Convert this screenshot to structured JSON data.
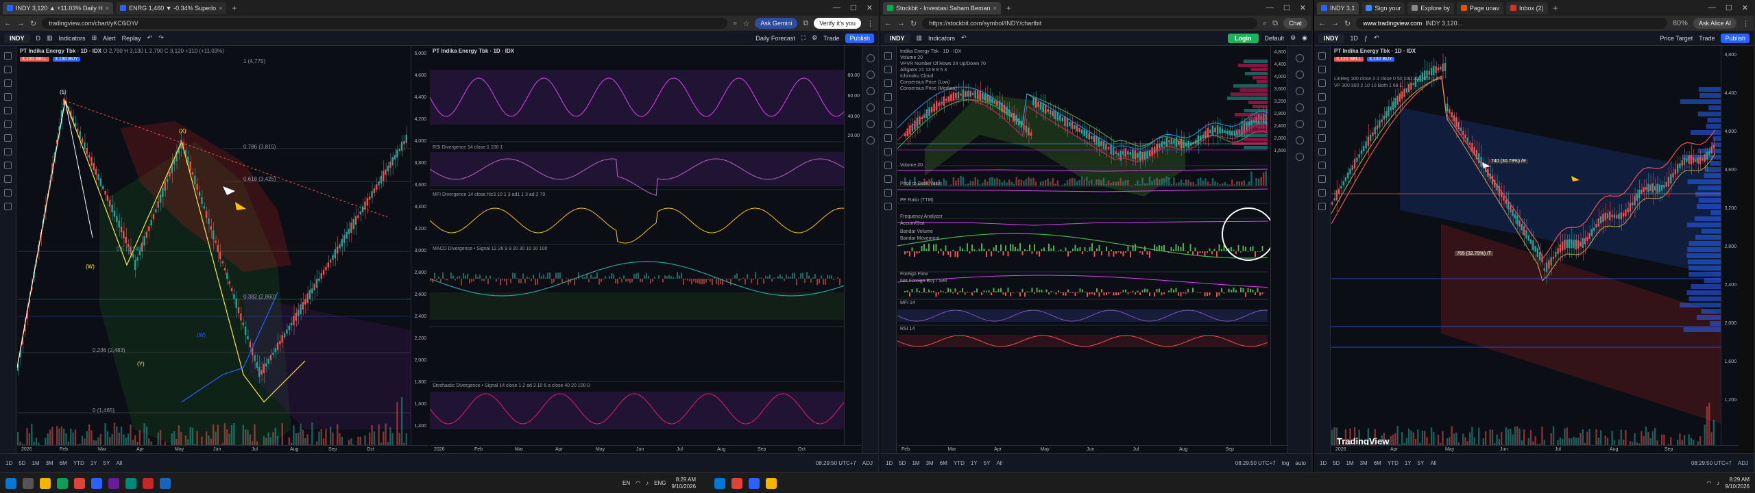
{
  "w1": {
    "tabs": [
      {
        "label": "INDY 3,120 ▲ +11.03% Daily H",
        "active": true
      },
      {
        "label": "ENRG 1,460 ▼ -0.34% Superlo",
        "active": false
      }
    ],
    "url": "tradingview.com/chart/yKC6iDYi/",
    "ask_label": "Ask Gemini",
    "verify_label": "Verify it's you",
    "toolbar": {
      "symbol": "INDY",
      "interval": "D",
      "indicators": "Indicators",
      "alert": "Alert",
      "replay": "Replay",
      "forecast": "Daily Forecast",
      "trade": "Trade",
      "publish": "Publish"
    },
    "main_legend": "PT Indika Energy Tbk · 1D · IDX",
    "main_values": "O 2,790 H 3,130 L 2,790 C 3,120 +310 (+11.03%)",
    "sell_badge": "3,120 SELL",
    "buy_badge": "3,130 BUY",
    "wave_labels": [
      "(5)",
      "(W)",
      "(X)",
      "(Y)",
      "(W)"
    ],
    "fib_labels": [
      "1 (4,775)",
      "0.786 (3,815)",
      "0.618 (3,425)",
      "0.5 (3,148)",
      "0.382 (2,860)",
      "0.236 (2,483)",
      "0 (1,465)"
    ],
    "price_axis": [
      "5,000",
      "4,600",
      "4,400",
      "4,200",
      "4,000",
      "3,800",
      "3,600",
      "3,400",
      "3,200",
      "3,000",
      "2,800",
      "2,600",
      "2,400",
      "2,200",
      "2,000",
      "1,800",
      "1,600",
      "1,400"
    ],
    "time_axis": [
      "2026",
      "Feb",
      "Mar",
      "Apr",
      "May",
      "Jun",
      "Jul",
      "Aug",
      "Sep",
      "Oct"
    ],
    "panel2_legend": "PT Indika Energy Tbk · 1D · IDX",
    "ind_legends": [
      "RSI Divergence 14 close 1 100 1",
      "MFI Divergence 14 close hlc3 10 1 3 ad1 1 3 ad 2 70",
      "MACD Divergence • Signal 12 26 9 9 20 30 10 10 100",
      "Stochastic Divergence • Signal 14 close 1 2 ad 3 10 6 a close 40 20 100 0"
    ],
    "osc_axis": [
      "80.00",
      "60.00",
      "40.00",
      "20.00"
    ],
    "ranges": [
      "1D",
      "5D",
      "1M",
      "3M",
      "6M",
      "YTD",
      "1Y",
      "5Y",
      "All"
    ],
    "time_status": "08:29:50 UTC+7",
    "adj": "ADJ"
  },
  "w2": {
    "tab_label": "Stockbit - Investasi Saham Beman",
    "url": "https://stockbit.com/symbol/INDY/chartbit",
    "chat": "Chat",
    "toolbar": {
      "symbol": "INDY",
      "indicators": "Indicators",
      "login": "Login",
      "default": "Default"
    },
    "legend_lines": [
      "Indika Energy Tbk · 1D · IDX",
      "Volume 20",
      "VPVR Number Of Rows 24 Up/Down 70",
      "Alligator 21 13 8 8 5 3",
      "Ichimoku Cloud",
      "Consensus Price (Low)",
      "Consensus Price (Median)"
    ],
    "panels": [
      "Volume 20",
      "Price to Book Value",
      "PE Ratio (TTM)",
      "Frequency Analyzer",
      "Accum/Dist",
      "Bandar Volume",
      "Bandar Movement",
      "Foreign Flow",
      "Net Foreign Buy / Sell",
      "MFI 14",
      "RSI 14"
    ],
    "price_axis": [
      "4,800",
      "4,400",
      "4,000",
      "3,600",
      "3,200",
      "2,800",
      "2,400",
      "2,000",
      "1,600"
    ],
    "time_axis": [
      "Feb",
      "Mar",
      "Apr",
      "May",
      "Jun",
      "Jul",
      "Aug",
      "Sep"
    ],
    "ranges": [
      "1D",
      "5D",
      "1M",
      "3M",
      "6M",
      "YTD",
      "1Y",
      "5Y",
      "All"
    ],
    "time_status": "08:29:50 UTC+7",
    "log": "log",
    "auto": "auto"
  },
  "w3": {
    "tabs": [
      {
        "label": "INDY 3,1",
        "active": true
      },
      {
        "label": "Sign your",
        "active": false
      },
      {
        "label": "Explore by",
        "active": false
      },
      {
        "label": "Page unav",
        "active": false
      },
      {
        "label": "Inbox (2)",
        "active": false
      }
    ],
    "url": "www.tradingview.com",
    "title_text": "INDY 3,120...",
    "zoom": "80%",
    "ask": "Ask Alice AI",
    "toolbar": {
      "symbol": "INDY",
      "interval": "1D",
      "price_target": "Price Target",
      "trade": "Trade",
      "publish": "Publish"
    },
    "legend": "PT Indika Energy Tbk · 1D · IDX",
    "lines": [
      "LinReg 100 close 3 3 close 0 50 100 200 400 1 3 0",
      "VP 300 300 2 10 10 Both 1 68 1"
    ],
    "sell_badge": "3,120 SELL",
    "buy_badge": "3,130 BUY",
    "callout": "740 (30.79%) /R",
    "callout2": "765 (32.79%) /T",
    "watermark": "TradingView",
    "price_axis": [
      "4,800",
      "4,400",
      "4,000",
      "3,600",
      "3,200",
      "2,800",
      "2,400",
      "2,000",
      "1,600",
      "1,200"
    ],
    "time_axis": [
      "2026",
      "Apr",
      "May",
      "Jun",
      "Jul",
      "Aug",
      "Sep"
    ],
    "ranges": [
      "1D",
      "5D",
      "1M",
      "3M",
      "6M",
      "YTD",
      "1Y",
      "5Y",
      "All"
    ],
    "time_status": "08:29:50 UTC+7",
    "adj": "ADJ"
  },
  "taskbar": {
    "lang": "ENG",
    "region": "EN",
    "time": "8:29 AM",
    "date": "9/10/2026",
    "time2": "8:29 AM",
    "date2": "9/10/2026"
  },
  "colors": {
    "bg": "#0b0e15",
    "up": "#26a69a",
    "down": "#ef5350",
    "accent": "#2962ff",
    "purple_band": "#4a1d6e"
  }
}
